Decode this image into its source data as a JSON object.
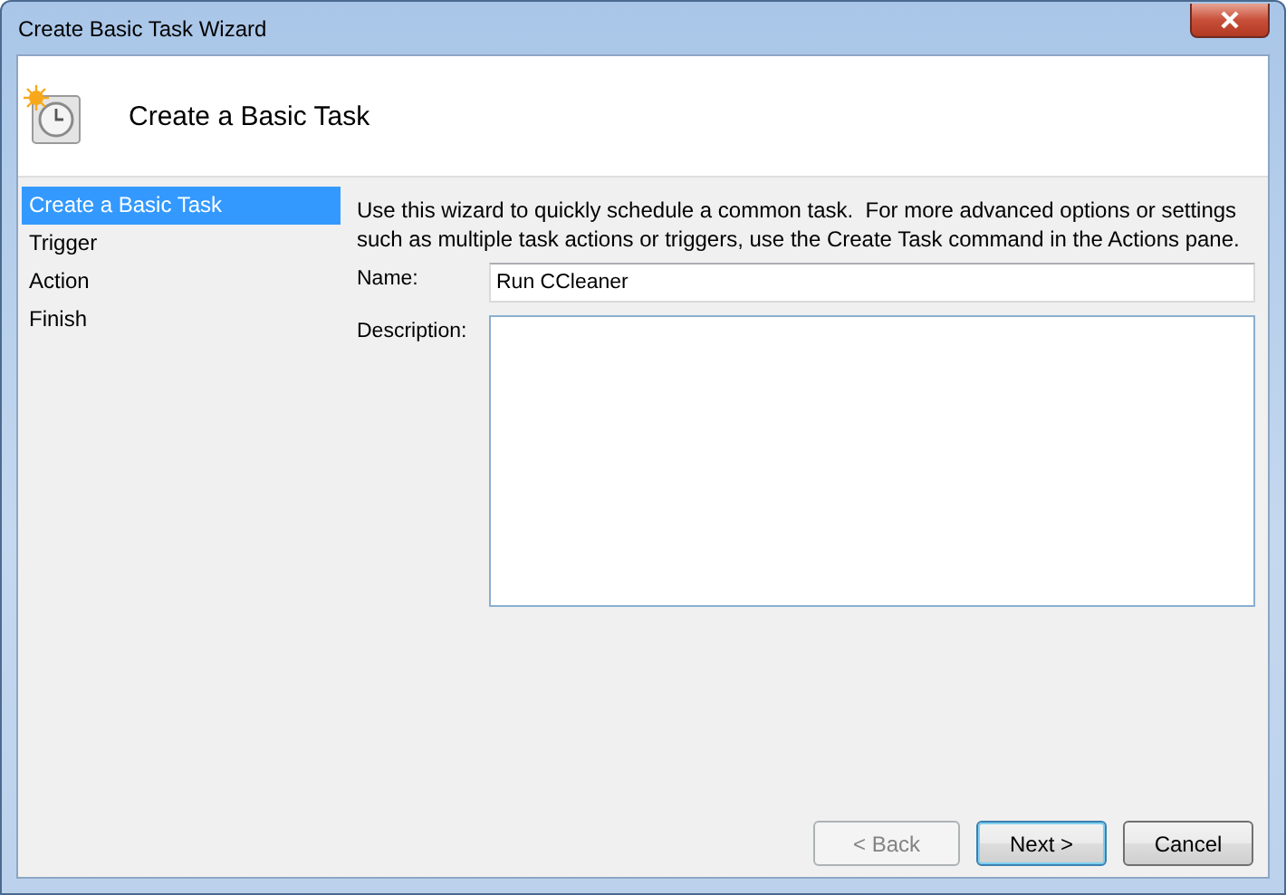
{
  "window": {
    "title": "Create Basic Task Wizard"
  },
  "header": {
    "title": "Create a Basic Task"
  },
  "steps": [
    {
      "label": "Create a Basic Task",
      "selected": true
    },
    {
      "label": "Trigger",
      "selected": false
    },
    {
      "label": "Action",
      "selected": false
    },
    {
      "label": "Finish",
      "selected": false
    }
  ],
  "intro": "Use this wizard to quickly schedule a common task.  For more advanced options or settings such as multiple task actions or triggers, use the Create Task command in the Actions pane.",
  "name_field": {
    "label": "Name:",
    "value": "Run CCleaner"
  },
  "description_field": {
    "label": "Description:"
  },
  "buttons": [
    {
      "label": "< Back",
      "disabled": true,
      "default": false
    },
    {
      "label": "Next >",
      "disabled": false,
      "default": true
    },
    {
      "label": "Cancel",
      "disabled": false,
      "default": false
    }
  ]
}
